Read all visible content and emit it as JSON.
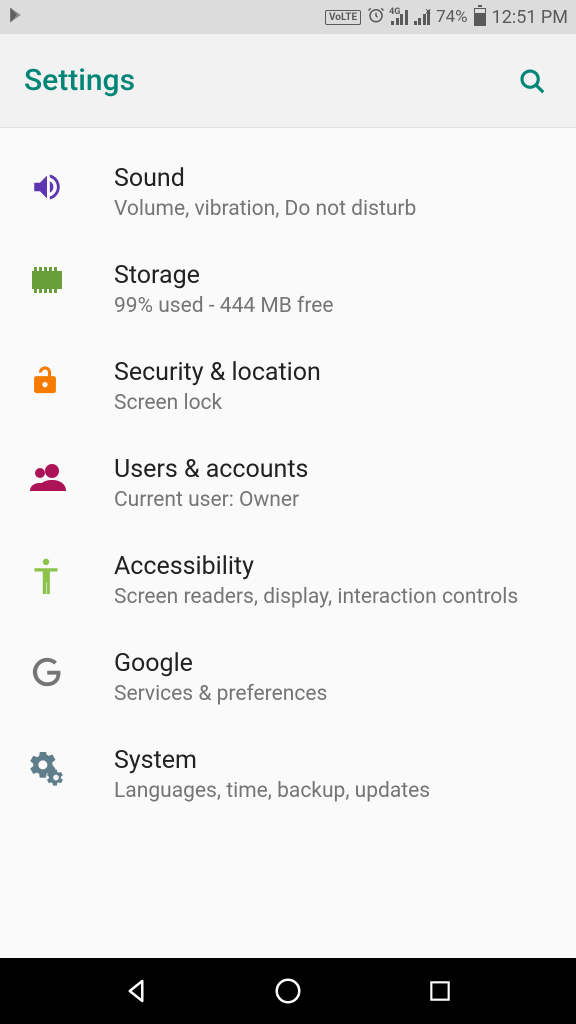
{
  "status": {
    "volte": "VoLTE",
    "network_gen": "4G",
    "battery_pct": "74%",
    "time": "12:51 PM"
  },
  "header": {
    "title": "Settings"
  },
  "items": [
    {
      "title": "Sound",
      "subtitle": "Volume, vibration, Do not disturb"
    },
    {
      "title": "Storage",
      "subtitle": "99% used - 444 MB free"
    },
    {
      "title": "Security & location",
      "subtitle": "Screen lock"
    },
    {
      "title": "Users & accounts",
      "subtitle": "Current user: Owner"
    },
    {
      "title": "Accessibility",
      "subtitle": "Screen readers, display, interaction controls"
    },
    {
      "title": "Google",
      "subtitle": "Services & preferences"
    },
    {
      "title": "System",
      "subtitle": "Languages, time, backup, updates"
    }
  ]
}
